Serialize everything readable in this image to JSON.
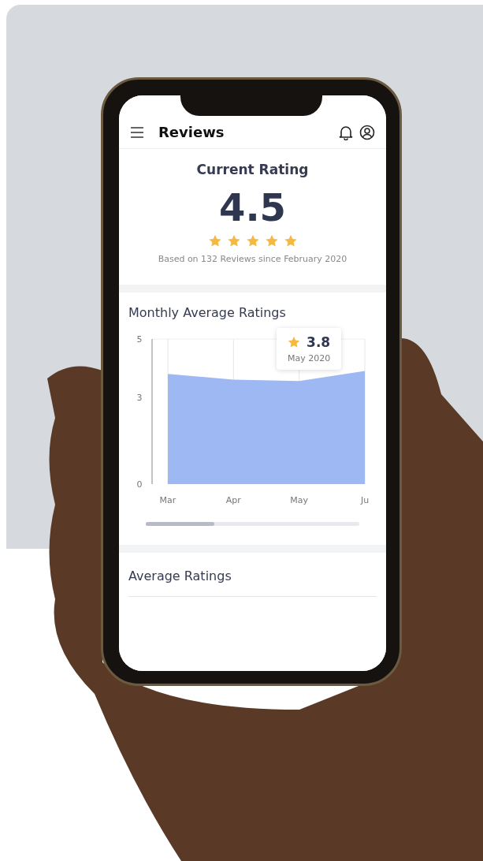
{
  "app_bar": {
    "title": "Reviews"
  },
  "current_rating": {
    "title": "Current Rating",
    "value": "4.5",
    "stars": 5,
    "caption": "Based on 132 Reviews since February 2020"
  },
  "monthly": {
    "title": "Monthly Average Ratings",
    "tooltip": {
      "value": "3.8",
      "label": "May 2020"
    },
    "chart_data": {
      "type": "area",
      "categories": [
        "Mar",
        "Apr",
        "May",
        "Ju"
      ],
      "series": [
        {
          "color": "#9db8f2",
          "values": [
            3.8,
            3.6,
            3.55,
            3.9
          ]
        }
      ],
      "ylim": [
        0,
        5
      ],
      "yticks": [
        0,
        3,
        5
      ],
      "grid": true
    }
  },
  "average": {
    "title": "Average Ratings"
  }
}
